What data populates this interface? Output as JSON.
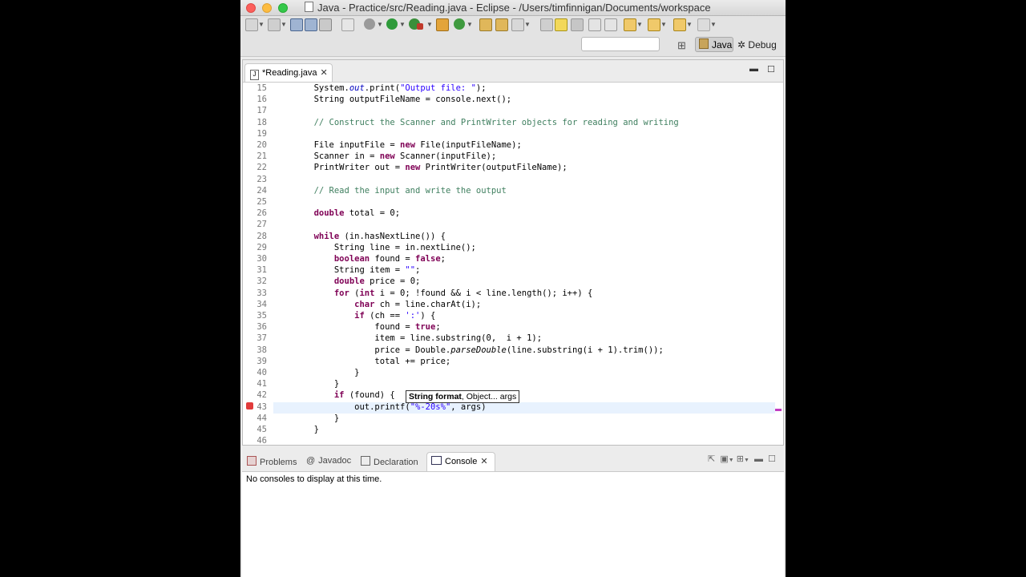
{
  "window": {
    "title": "Java - Practice/src/Reading.java - Eclipse - /Users/timfinnigan/Documents/workspace"
  },
  "toolbar": {
    "quick_access_placeholder": "",
    "perspective_java": "Java",
    "perspective_debug": "Debug"
  },
  "editor": {
    "tab_label": "*Reading.java",
    "lines": [
      {
        "n": "15",
        "html": "        System.<span class=\"fld\">out</span>.print(<span class=\"str\">\"Output file: \"</span>);"
      },
      {
        "n": "16",
        "html": "        String outputFileName = console.next();"
      },
      {
        "n": "17",
        "html": ""
      },
      {
        "n": "18",
        "html": "        <span class=\"cm\">// Construct the Scanner and PrintWriter objects for reading and writing</span>"
      },
      {
        "n": "19",
        "html": ""
      },
      {
        "n": "20",
        "html": "        File inputFile = <span class=\"kw\">new</span> File(inputFileName);"
      },
      {
        "n": "21",
        "html": "        Scanner in = <span class=\"kw\">new</span> Scanner(inputFile);"
      },
      {
        "n": "22",
        "html": "        PrintWriter out = <span class=\"kw\">new</span> PrintWriter(outputFileName);"
      },
      {
        "n": "23",
        "html": ""
      },
      {
        "n": "24",
        "html": "        <span class=\"cm\">// Read the input and write the output</span>"
      },
      {
        "n": "25",
        "html": ""
      },
      {
        "n": "26",
        "html": "        <span class=\"kw\">double</span> total = 0;"
      },
      {
        "n": "27",
        "html": ""
      },
      {
        "n": "28",
        "html": "        <span class=\"kw\">while</span> (in.hasNextLine()) {"
      },
      {
        "n": "29",
        "html": "            String line = in.nextLine();"
      },
      {
        "n": "30",
        "html": "            <span class=\"kw\">boolean</span> found = <span class=\"kw\">false</span>;"
      },
      {
        "n": "31",
        "html": "            String item = <span class=\"str\">\"\"</span>;"
      },
      {
        "n": "32",
        "html": "            <span class=\"kw\">double</span> price = 0;"
      },
      {
        "n": "33",
        "html": "            <span class=\"kw\">for</span> (<span class=\"kw\">int</span> i = 0; !found &amp;&amp; i &lt; line.length(); i++) {"
      },
      {
        "n": "34",
        "html": "                <span class=\"kw\">char</span> ch = line.charAt(i);"
      },
      {
        "n": "35",
        "html": "                <span class=\"kw\">if</span> (ch == <span class=\"str\">':'</span>) {"
      },
      {
        "n": "36",
        "html": "                    found = <span class=\"kw\">true</span>;"
      },
      {
        "n": "37",
        "html": "                    item = line.substring(0,  i + 1);"
      },
      {
        "n": "38",
        "html": "                    price = Double.<span class=\"st\">parseDouble</span>(line.substring(i + 1).trim());"
      },
      {
        "n": "39",
        "html": "                    total += price;"
      },
      {
        "n": "40",
        "html": "                }"
      },
      {
        "n": "41",
        "html": "            }"
      },
      {
        "n": "42",
        "html": "            <span class=\"kw\">if</span> (found) {"
      },
      {
        "n": "43",
        "html": "                out.printf(<span class=\"str\">\"%-20s%\"</span>, args)"
      },
      {
        "n": "44",
        "html": "            }"
      },
      {
        "n": "45",
        "html": "        }"
      },
      {
        "n": "46",
        "html": ""
      }
    ],
    "hint": {
      "bold": "String format",
      "rest": ", Object... args"
    }
  },
  "bottom": {
    "tabs": {
      "problems": "Problems",
      "javadoc": "Javadoc",
      "declaration": "Declaration",
      "console": "Console"
    },
    "console_message": "No consoles to display at this time."
  }
}
